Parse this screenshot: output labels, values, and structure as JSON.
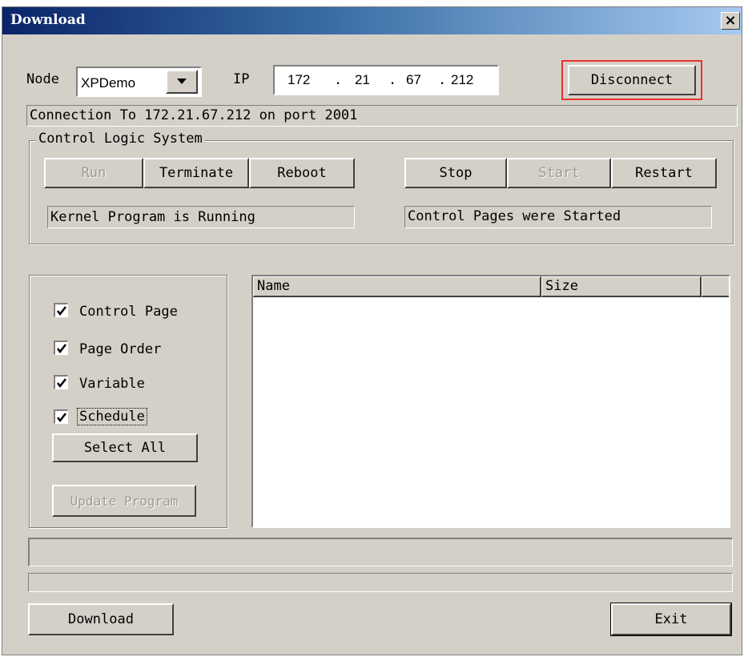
{
  "window": {
    "title": "Download",
    "close_label": "×"
  },
  "connection": {
    "node_label": "Node",
    "node_value": "XPDemo",
    "ip_label": "IP",
    "ip_octets": [
      "172",
      "21",
      "67",
      "212"
    ],
    "disconnect_label": "Disconnect",
    "status": "Connection To 172.21.67.212 on port 2001"
  },
  "control_logic": {
    "group_title": "Control Logic System",
    "run_label": "Run",
    "terminate_label": "Terminate",
    "reboot_label": "Reboot",
    "stop_label": "Stop",
    "start_label": "Start",
    "restart_label": "Restart",
    "kernel_status": "Kernel Program is Running",
    "pages_status": "Control Pages were Started"
  },
  "options": {
    "checkboxes": [
      {
        "label": "Control Page",
        "checked": true
      },
      {
        "label": "Page Order",
        "checked": true
      },
      {
        "label": "Variable",
        "checked": true
      },
      {
        "label": "Schedule",
        "checked": true
      }
    ],
    "select_all_label": "Select All",
    "update_program_label": "Update Program"
  },
  "file_list": {
    "columns": [
      "Name",
      "Size"
    ],
    "rows": []
  },
  "footer": {
    "download_label": "Download",
    "exit_label": "Exit"
  },
  "colors": {
    "highlight": "#e8322f",
    "dialog_bg": "#d4d0c8"
  }
}
